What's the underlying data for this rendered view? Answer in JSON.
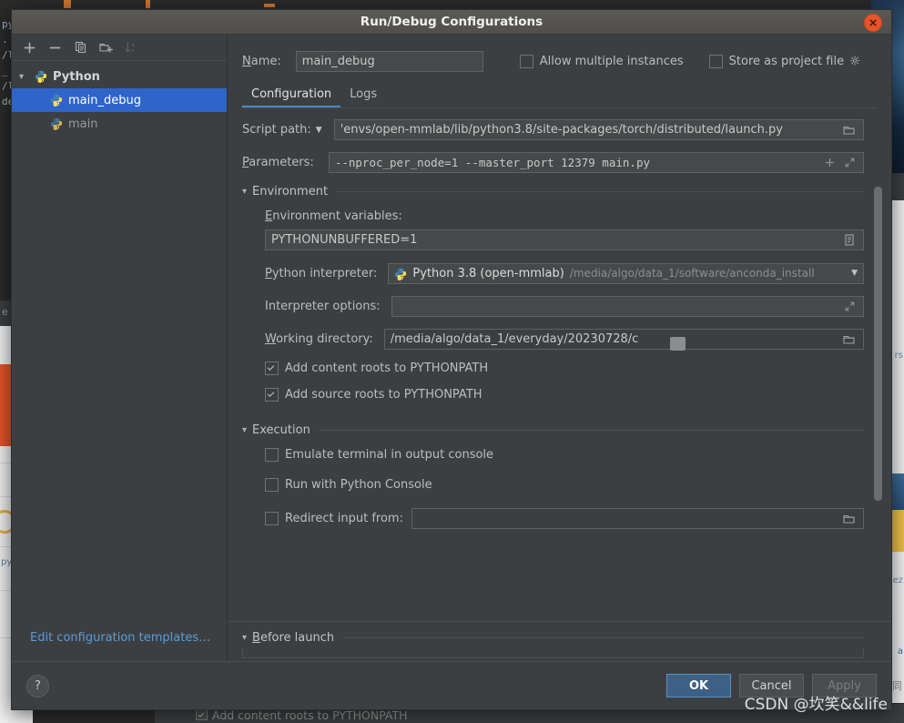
{
  "window": {
    "title": "Run/Debug Configurations",
    "close_icon": "close-icon"
  },
  "toolbar": {
    "add": "+",
    "remove": "−",
    "copy": "copy-icon",
    "new_folder": "folder-add-icon",
    "sort": "sort-alphabetical-icon"
  },
  "tree": {
    "group_label": "Python",
    "items": [
      {
        "label": "main_debug",
        "selected": true
      },
      {
        "label": "main",
        "selected": false
      }
    ]
  },
  "left_footer": {
    "edit_templates": "Edit configuration templates…"
  },
  "name_row": {
    "label": "Name:",
    "label_mnemonic": "N",
    "value": "main_debug",
    "allow_multiple_instances": "Allow multiple instances",
    "allow_multiple_checked": false,
    "store_as_project_file": "Store as project file",
    "store_as_project_checked": false,
    "gear_icon": "gear-icon"
  },
  "tabs": [
    {
      "label": "Configuration",
      "active": true
    },
    {
      "label": "Logs",
      "active": false
    }
  ],
  "configuration": {
    "script_path": {
      "label": "Script path:",
      "value": "'envs/open-mmlab/lib/python3.8/site-packages/torch/distributed/launch.py",
      "browse_icon": "folder-icon",
      "dropdown_icon": "caret-down-icon"
    },
    "parameters": {
      "label": "Parameters:",
      "label_mnemonic": "P",
      "value": "--nproc_per_node=1  --master_port 12379 main.py",
      "add_icon": "plus-icon",
      "expand_icon": "expand-icon"
    },
    "environment": {
      "section_title": "Environment",
      "env_vars": {
        "label": "Environment variables:",
        "label_mnemonic": "E",
        "value": "PYTHONUNBUFFERED=1",
        "edit_icon": "list-edit-icon"
      },
      "interpreter": {
        "label": "Python interpreter:",
        "label_mnemonic": "P",
        "name": "Python 3.8 (open-mmlab)",
        "path": "/media/algo/data_1/software/anconda_install",
        "python_icon": "python-icon",
        "dropdown_icon": "caret-down-icon"
      },
      "interpreter_options": {
        "label": "Interpreter options:",
        "value": "",
        "expand_icon": "expand-icon"
      },
      "working_directory": {
        "label": "Working directory:",
        "label_mnemonic": "W",
        "value": "/media/algo/data_1/everyday/20230728/c",
        "browse_icon": "folder-icon"
      },
      "add_content_roots": {
        "label": "Add content roots to PYTHONPATH",
        "checked": true
      },
      "add_source_roots": {
        "label": "Add source roots to PYTHONPATH",
        "checked": true
      }
    },
    "execution": {
      "section_title": "Execution",
      "emulate_terminal": {
        "label": "Emulate terminal in output console",
        "checked": false
      },
      "run_with_console": {
        "label": "Run with Python Console",
        "checked": false
      },
      "redirect_input": {
        "label": "Redirect input from:",
        "checked": false,
        "value": "",
        "browse_icon": "folder-icon"
      }
    },
    "before_launch": {
      "section_title": "Before launch",
      "mnemonic": "B"
    }
  },
  "bottom_bar": {
    "help": "?",
    "ok": "OK",
    "cancel": "Cancel",
    "apply": "Apply",
    "apply_disabled": true
  },
  "watermark": {
    "text": "CSDN @坎笑&&life"
  },
  "background": {
    "code_lines": "py\n. (\n/l\n_\n/l\nde",
    "bottom_window_text": "Add content roots to PYTHONPATH",
    "right_labels": [
      "rs",
      "ez",
      "a"
    ],
    "cn_label": "同"
  },
  "colors": {
    "dialog_bg": "#3c3f41",
    "selection_blue": "#2f65ca",
    "accent_blue": "#4a88c7",
    "link_blue": "#5b9bd5",
    "close_red": "#e8542a",
    "ok_button": "#3d6185",
    "field_bg": "#45494a",
    "text": "#bbbbbb"
  }
}
